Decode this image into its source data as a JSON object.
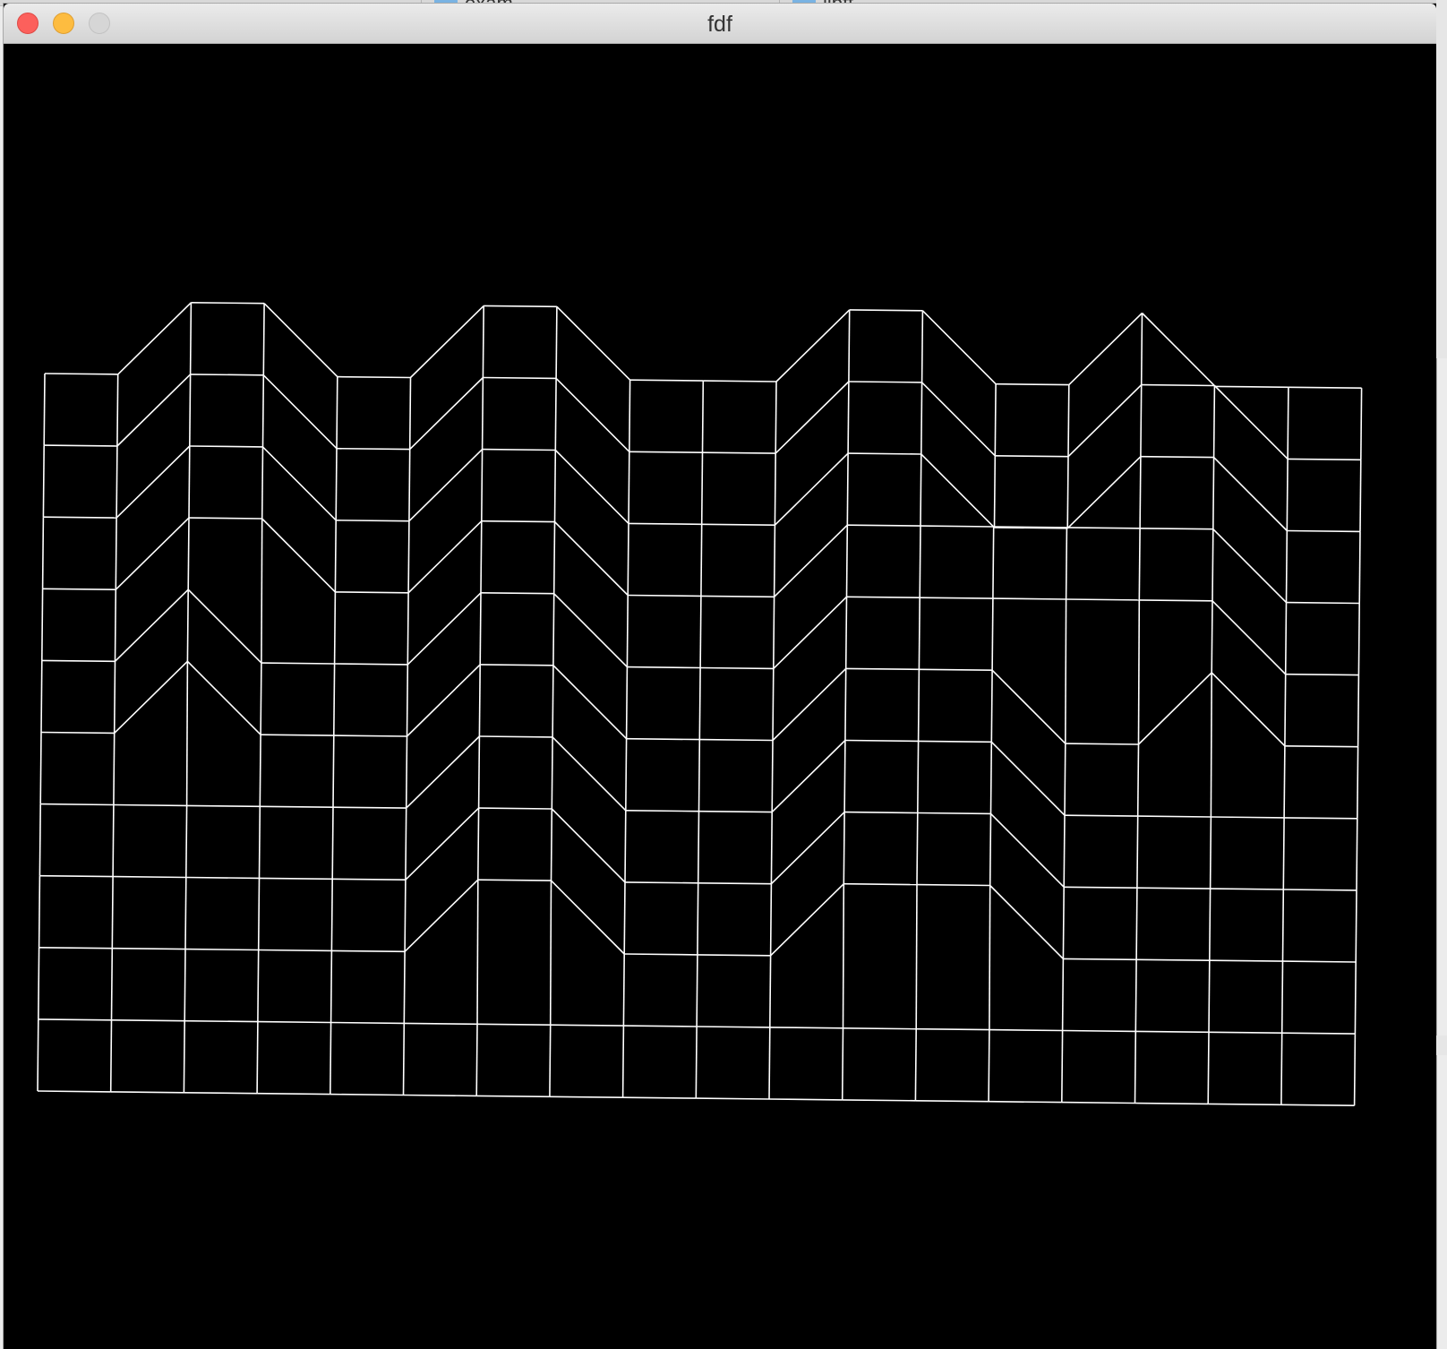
{
  "background": {
    "tabs": [
      {
        "label": "exam"
      },
      {
        "label": "libft"
      }
    ]
  },
  "window": {
    "title": "fdf",
    "controls": {
      "close": "close-icon",
      "minimize": "minimize-icon",
      "zoom": "zoom-icon"
    }
  },
  "render": {
    "line_color": "#ffffff",
    "background_color": "#000000",
    "projection": "isometric",
    "grid_columns": 19,
    "grid_rows": 11,
    "heights": [
      [
        0,
        0,
        10,
        10,
        0,
        0,
        10,
        10,
        0,
        0,
        0,
        10,
        10,
        0,
        0,
        10,
        0,
        0,
        0
      ],
      [
        0,
        0,
        10,
        10,
        0,
        0,
        10,
        10,
        0,
        0,
        0,
        10,
        10,
        0,
        0,
        10,
        10,
        0,
        0
      ],
      [
        0,
        0,
        10,
        10,
        0,
        0,
        10,
        10,
        0,
        0,
        0,
        10,
        10,
        0,
        0,
        10,
        10,
        0,
        0
      ],
      [
        0,
        0,
        10,
        10,
        0,
        0,
        10,
        10,
        0,
        0,
        0,
        10,
        10,
        10,
        10,
        10,
        10,
        0,
        0
      ],
      [
        0,
        0,
        10,
        0,
        0,
        0,
        10,
        10,
        0,
        0,
        0,
        10,
        10,
        10,
        10,
        10,
        10,
        0,
        0
      ],
      [
        0,
        0,
        10,
        0,
        0,
        0,
        10,
        10,
        0,
        0,
        0,
        10,
        10,
        10,
        0,
        0,
        10,
        0,
        0
      ],
      [
        0,
        0,
        0,
        0,
        0,
        0,
        10,
        10,
        0,
        0,
        0,
        10,
        10,
        10,
        0,
        0,
        0,
        0,
        0
      ],
      [
        0,
        0,
        0,
        0,
        0,
        0,
        10,
        10,
        0,
        0,
        0,
        10,
        10,
        10,
        0,
        0,
        0,
        0,
        0
      ],
      [
        0,
        0,
        0,
        0,
        0,
        0,
        10,
        10,
        0,
        0,
        0,
        10,
        10,
        10,
        0,
        0,
        0,
        0,
        0
      ],
      [
        0,
        0,
        0,
        0,
        0,
        0,
        0,
        0,
        0,
        0,
        0,
        0,
        0,
        0,
        0,
        0,
        0,
        0,
        0
      ],
      [
        0,
        0,
        0,
        0,
        0,
        0,
        0,
        0,
        0,
        0,
        0,
        0,
        0,
        0,
        0,
        0,
        0,
        0,
        0
      ]
    ]
  }
}
